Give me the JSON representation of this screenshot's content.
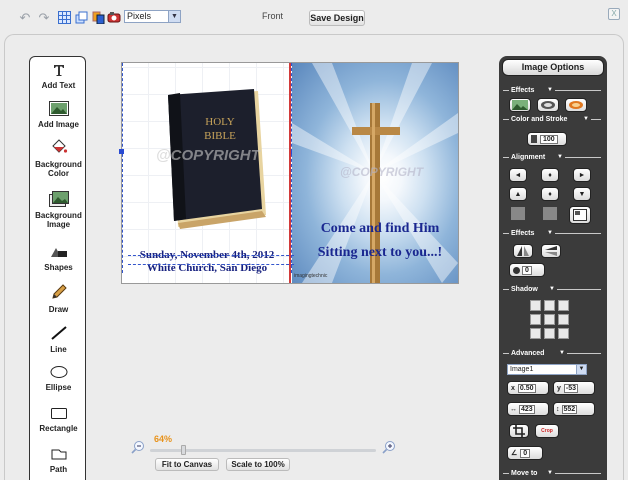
{
  "toolbar": {
    "undo_icon": "undo-icon",
    "redo_icon": "redo-icon",
    "units_value": "Pixels",
    "side_label": "Front",
    "save_label": "Save Design",
    "close_label": "X"
  },
  "tools": [
    {
      "label": "Add Text",
      "icon": "text-tool-icon"
    },
    {
      "label": "Add Image",
      "icon": "image-tool-icon"
    },
    {
      "label": "Background Color",
      "icon": "paint-bucket-icon"
    },
    {
      "label": "Background Image",
      "icon": "background-image-icon"
    },
    {
      "label": "Shapes",
      "icon": "shapes-icon"
    },
    {
      "label": "Draw",
      "icon": "pencil-icon"
    },
    {
      "label": "Line",
      "icon": "line-icon"
    },
    {
      "label": "Ellipse",
      "icon": "ellipse-icon"
    },
    {
      "label": "Rectangle",
      "icon": "rectangle-icon"
    },
    {
      "label": "Path",
      "icon": "path-icon"
    }
  ],
  "canvas": {
    "watermark": "@COPYRIGHT",
    "bible_text_1": "HOLY",
    "bible_text_2": "BIBLE",
    "event_line_1": "Sunday, November 4th, 2012",
    "event_line_2": "White Church, San Diego",
    "invite_line_1": "Come and find Him",
    "invite_line_2": "Sitting next to you...!",
    "image_credit": "imagingtechnic"
  },
  "zoom": {
    "percent": "64%",
    "level": 0.64,
    "fit_label": "Fit to Canvas",
    "scale_label": "Scale to 100%"
  },
  "options": {
    "title": "Image Options",
    "sections": {
      "effects": "Effects",
      "color_stroke": "Color and Stroke",
      "alignment": "Alignment",
      "effects2": "Effects",
      "shadow": "Shadow",
      "advanced": "Advanced",
      "move_to": "Move to"
    },
    "stroke_value": "100",
    "blur_value": "0",
    "layer_value": "Image1",
    "x_label": "x",
    "x_value": "0.50",
    "y_label": "y",
    "y_value": "-53",
    "width_value": "423",
    "height_value": "552",
    "rotate_value": "0",
    "crop_label": "Crop"
  },
  "colors": {
    "accent": "#e8921a",
    "panel": "#3b3b3b",
    "text_blue": "#1a2790"
  }
}
